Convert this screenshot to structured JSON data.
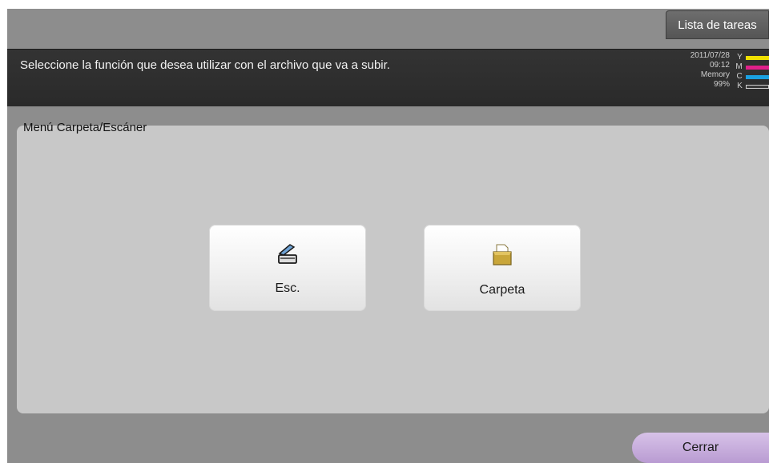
{
  "header": {
    "task_list_button": "Lista de tareas",
    "message": "Seleccione la función que desea utilizar con el archivo que va a subir."
  },
  "status": {
    "date": "2011/07/28",
    "time": "09:12",
    "memory_label": "Memory",
    "memory_value": "99%",
    "toner": [
      {
        "letter": "Y",
        "color": "#f0e000"
      },
      {
        "letter": "M",
        "color": "#e0208a"
      },
      {
        "letter": "C",
        "color": "#1aa0e0"
      },
      {
        "letter": "K",
        "color": "#3a3a3a"
      }
    ]
  },
  "panel": {
    "title": "Menú Carpeta/Escáner",
    "buttons": [
      {
        "label": "Esc.",
        "icon": "scanner-icon"
      },
      {
        "label": "Carpeta",
        "icon": "folder-icon"
      }
    ]
  },
  "footer": {
    "close_button": "Cerrar"
  },
  "colors": {
    "background": "#8d8d8d",
    "message_bar": "#2e2e2e",
    "panel": "#c8c8c8",
    "close_button": "#c9b0de"
  }
}
